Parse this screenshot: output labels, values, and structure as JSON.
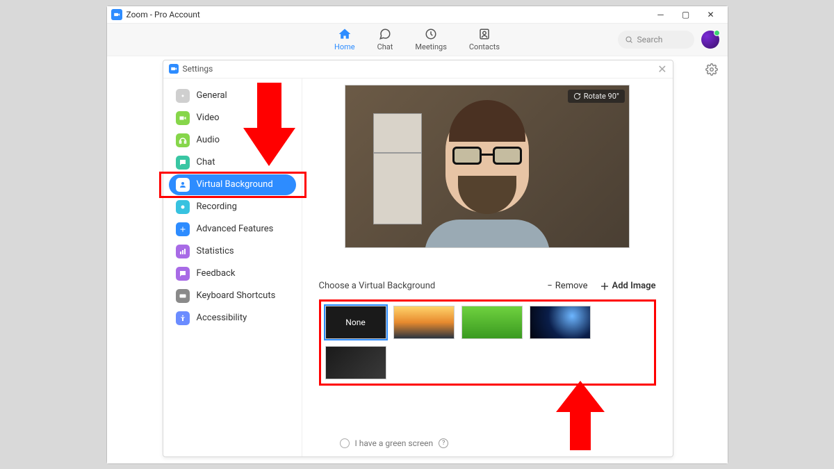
{
  "window": {
    "title": "Zoom - Pro Account"
  },
  "nav": {
    "tabs": [
      {
        "label": "Home"
      },
      {
        "label": "Chat"
      },
      {
        "label": "Meetings"
      },
      {
        "label": "Contacts"
      }
    ],
    "search_placeholder": "Search"
  },
  "settings": {
    "title": "Settings",
    "items": [
      {
        "label": "General",
        "color": "#cfcfcf"
      },
      {
        "label": "Video",
        "color": "#86d64a"
      },
      {
        "label": "Audio",
        "color": "#86d64a"
      },
      {
        "label": "Chat",
        "color": "#39c6a3"
      },
      {
        "label": "Virtual Background",
        "color": "#2d8cff",
        "selected": true
      },
      {
        "label": "Recording",
        "color": "#37c2e0"
      },
      {
        "label": "Advanced Features",
        "color": "#2d8cff"
      },
      {
        "label": "Statistics",
        "color": "#a86be6"
      },
      {
        "label": "Feedback",
        "color": "#a86be6"
      },
      {
        "label": "Keyboard Shortcuts",
        "color": "#8a8a8a"
      },
      {
        "label": "Accessibility",
        "color": "#6b8cff"
      }
    ]
  },
  "virtual_background": {
    "rotate_label": "Rotate 90°",
    "choose_label": "Choose a Virtual Background",
    "remove_label": "Remove",
    "add_label": "Add Image",
    "tiles": {
      "none": "None"
    },
    "green_screen_label": "I have a green screen"
  }
}
